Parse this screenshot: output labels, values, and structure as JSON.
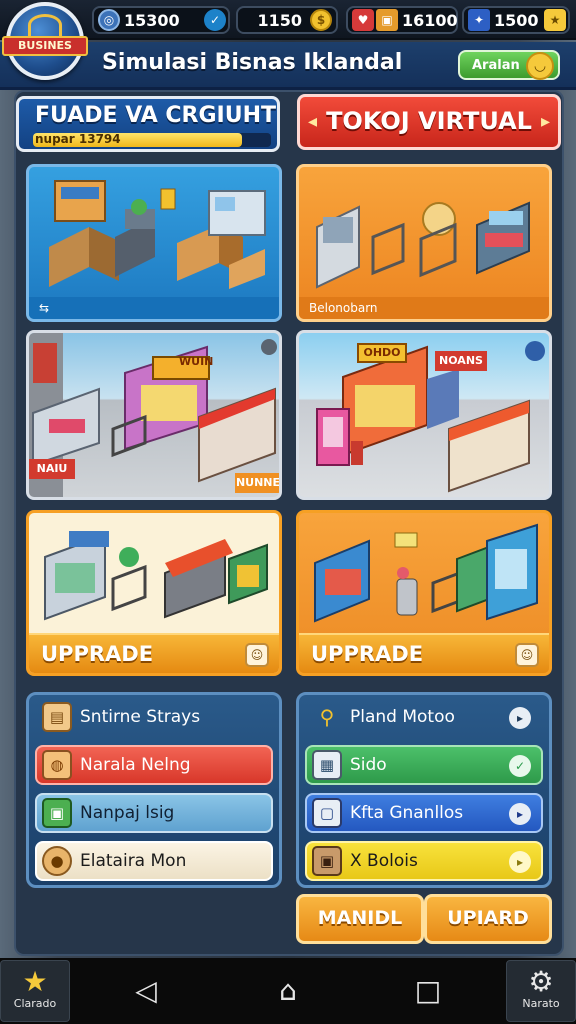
{
  "topbar": {
    "resources": [
      {
        "value": "15300",
        "icon": "globe-icon"
      },
      {
        "value": "1150",
        "icon": "coin-icon"
      },
      {
        "value": "16100",
        "icon": "crate-icon"
      },
      {
        "value": "1500",
        "icon": "star-chest-icon"
      }
    ]
  },
  "header": {
    "logo_text": "BUSINES",
    "title": "Simulasi Bisnas Iklandal",
    "action_label": "Aralan"
  },
  "left_header": {
    "title": "FUADE VA CRGIUHT",
    "progress_label": "nupar 13794",
    "progress_fraction": 0.88
  },
  "right_header": {
    "title": "TOKOJ VIRTUAL"
  },
  "cards": {
    "card1_footer": "⇆",
    "card2_footer": "Belonobarn",
    "card3_sign_top": "WUIN",
    "card3_sign_left": "NAIU",
    "card3_sign_right": "NUNNE",
    "card4_sign_top": "OHDO",
    "card4_sign_right": "NOANS",
    "upgrade_left": "UPPRADE",
    "upgrade_right": "UPPRADE"
  },
  "left_list": [
    {
      "label": "Sntirne Strays",
      "icon": "box-icon"
    },
    {
      "label": "Narala Nelng",
      "icon": "bread-icon"
    },
    {
      "label": "Nanpaj lsig",
      "icon": "package-icon"
    },
    {
      "label": "Elataira Mon",
      "icon": "cookie-icon"
    }
  ],
  "right_list": [
    {
      "label": "Pland Motoo",
      "icon": "magnifier-icon"
    },
    {
      "label": "Sido",
      "icon": "screen-icon"
    },
    {
      "label": "Kfta Gnanllos",
      "icon": "monitor-icon"
    },
    {
      "label": "X Bolois",
      "icon": "crate-icon"
    }
  ],
  "buttons": {
    "manual": "MANIDL",
    "upgrade": "UPIARD"
  },
  "navbar": {
    "left_label": "Clarado",
    "right_label": "Narato"
  },
  "colors": {
    "accent_orange": "#f09a22",
    "header_red": "#e0372a",
    "header_blue": "#1e5ba8",
    "row_red": "#e84a3c",
    "row_green": "#3cab54",
    "row_blue": "#2f6fd0",
    "row_yellow": "#f0d330"
  }
}
